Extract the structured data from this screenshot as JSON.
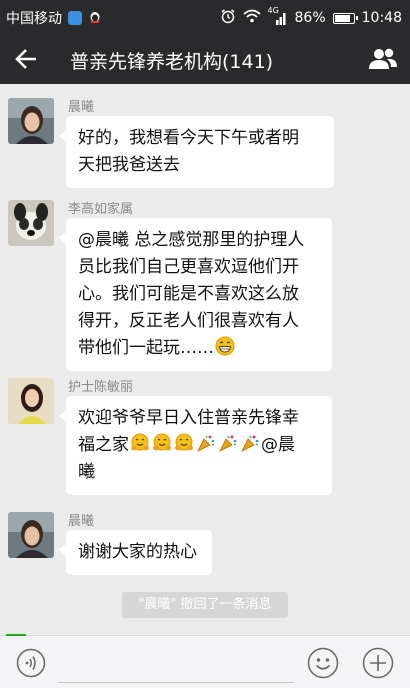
{
  "status_bar": {
    "carrier": "中国移动",
    "network": "4G",
    "battery": "86%",
    "battery_level": 0.86,
    "time": "10:48"
  },
  "header": {
    "title": "普亲先锋养老机构(141)",
    "back_icon": "arrow-left-icon",
    "members_icon": "group-members-icon"
  },
  "messages": [
    {
      "sender": "晨曦",
      "lines": [
        "好的，我想看今天下午或者明",
        "天把我爸送去"
      ]
    },
    {
      "sender": "李高如家属",
      "lines": [
        "@晨曦  总之感觉那里的护理人",
        "员比我们自己更喜欢逗他们开",
        "心。我们可能是不喜欢这么放",
        "得开，反正老人们很喜欢有人",
        "带他们一起玩……"
      ],
      "emoji": "grinning-emoji"
    },
    {
      "sender": "护士陈敏丽",
      "lines": [
        "欢迎爷爷早日入住普亲先锋幸",
        "福之家",
        "@晨",
        "曦"
      ],
      "emojis": [
        "hugging-emoji",
        "hugging-emoji",
        "hugging-emoji",
        "party-popper-emoji",
        "party-popper-emoji",
        "party-popper-emoji"
      ]
    },
    {
      "sender": "晨曦",
      "lines": [
        "谢谢大家的热心"
      ]
    }
  ],
  "system_notice": "\"晨曦\" 撤回了一条消息",
  "input_bar": {
    "voice_icon": "voice-icon",
    "emoji_icon": "emoji-icon",
    "plus_icon": "plus-icon",
    "value": ""
  },
  "colors": {
    "bar_bg": "#2a2a2d",
    "chat_bg": "#ebebeb",
    "bubble_bg": "#ffffff",
    "accent": "#1aad19"
  }
}
